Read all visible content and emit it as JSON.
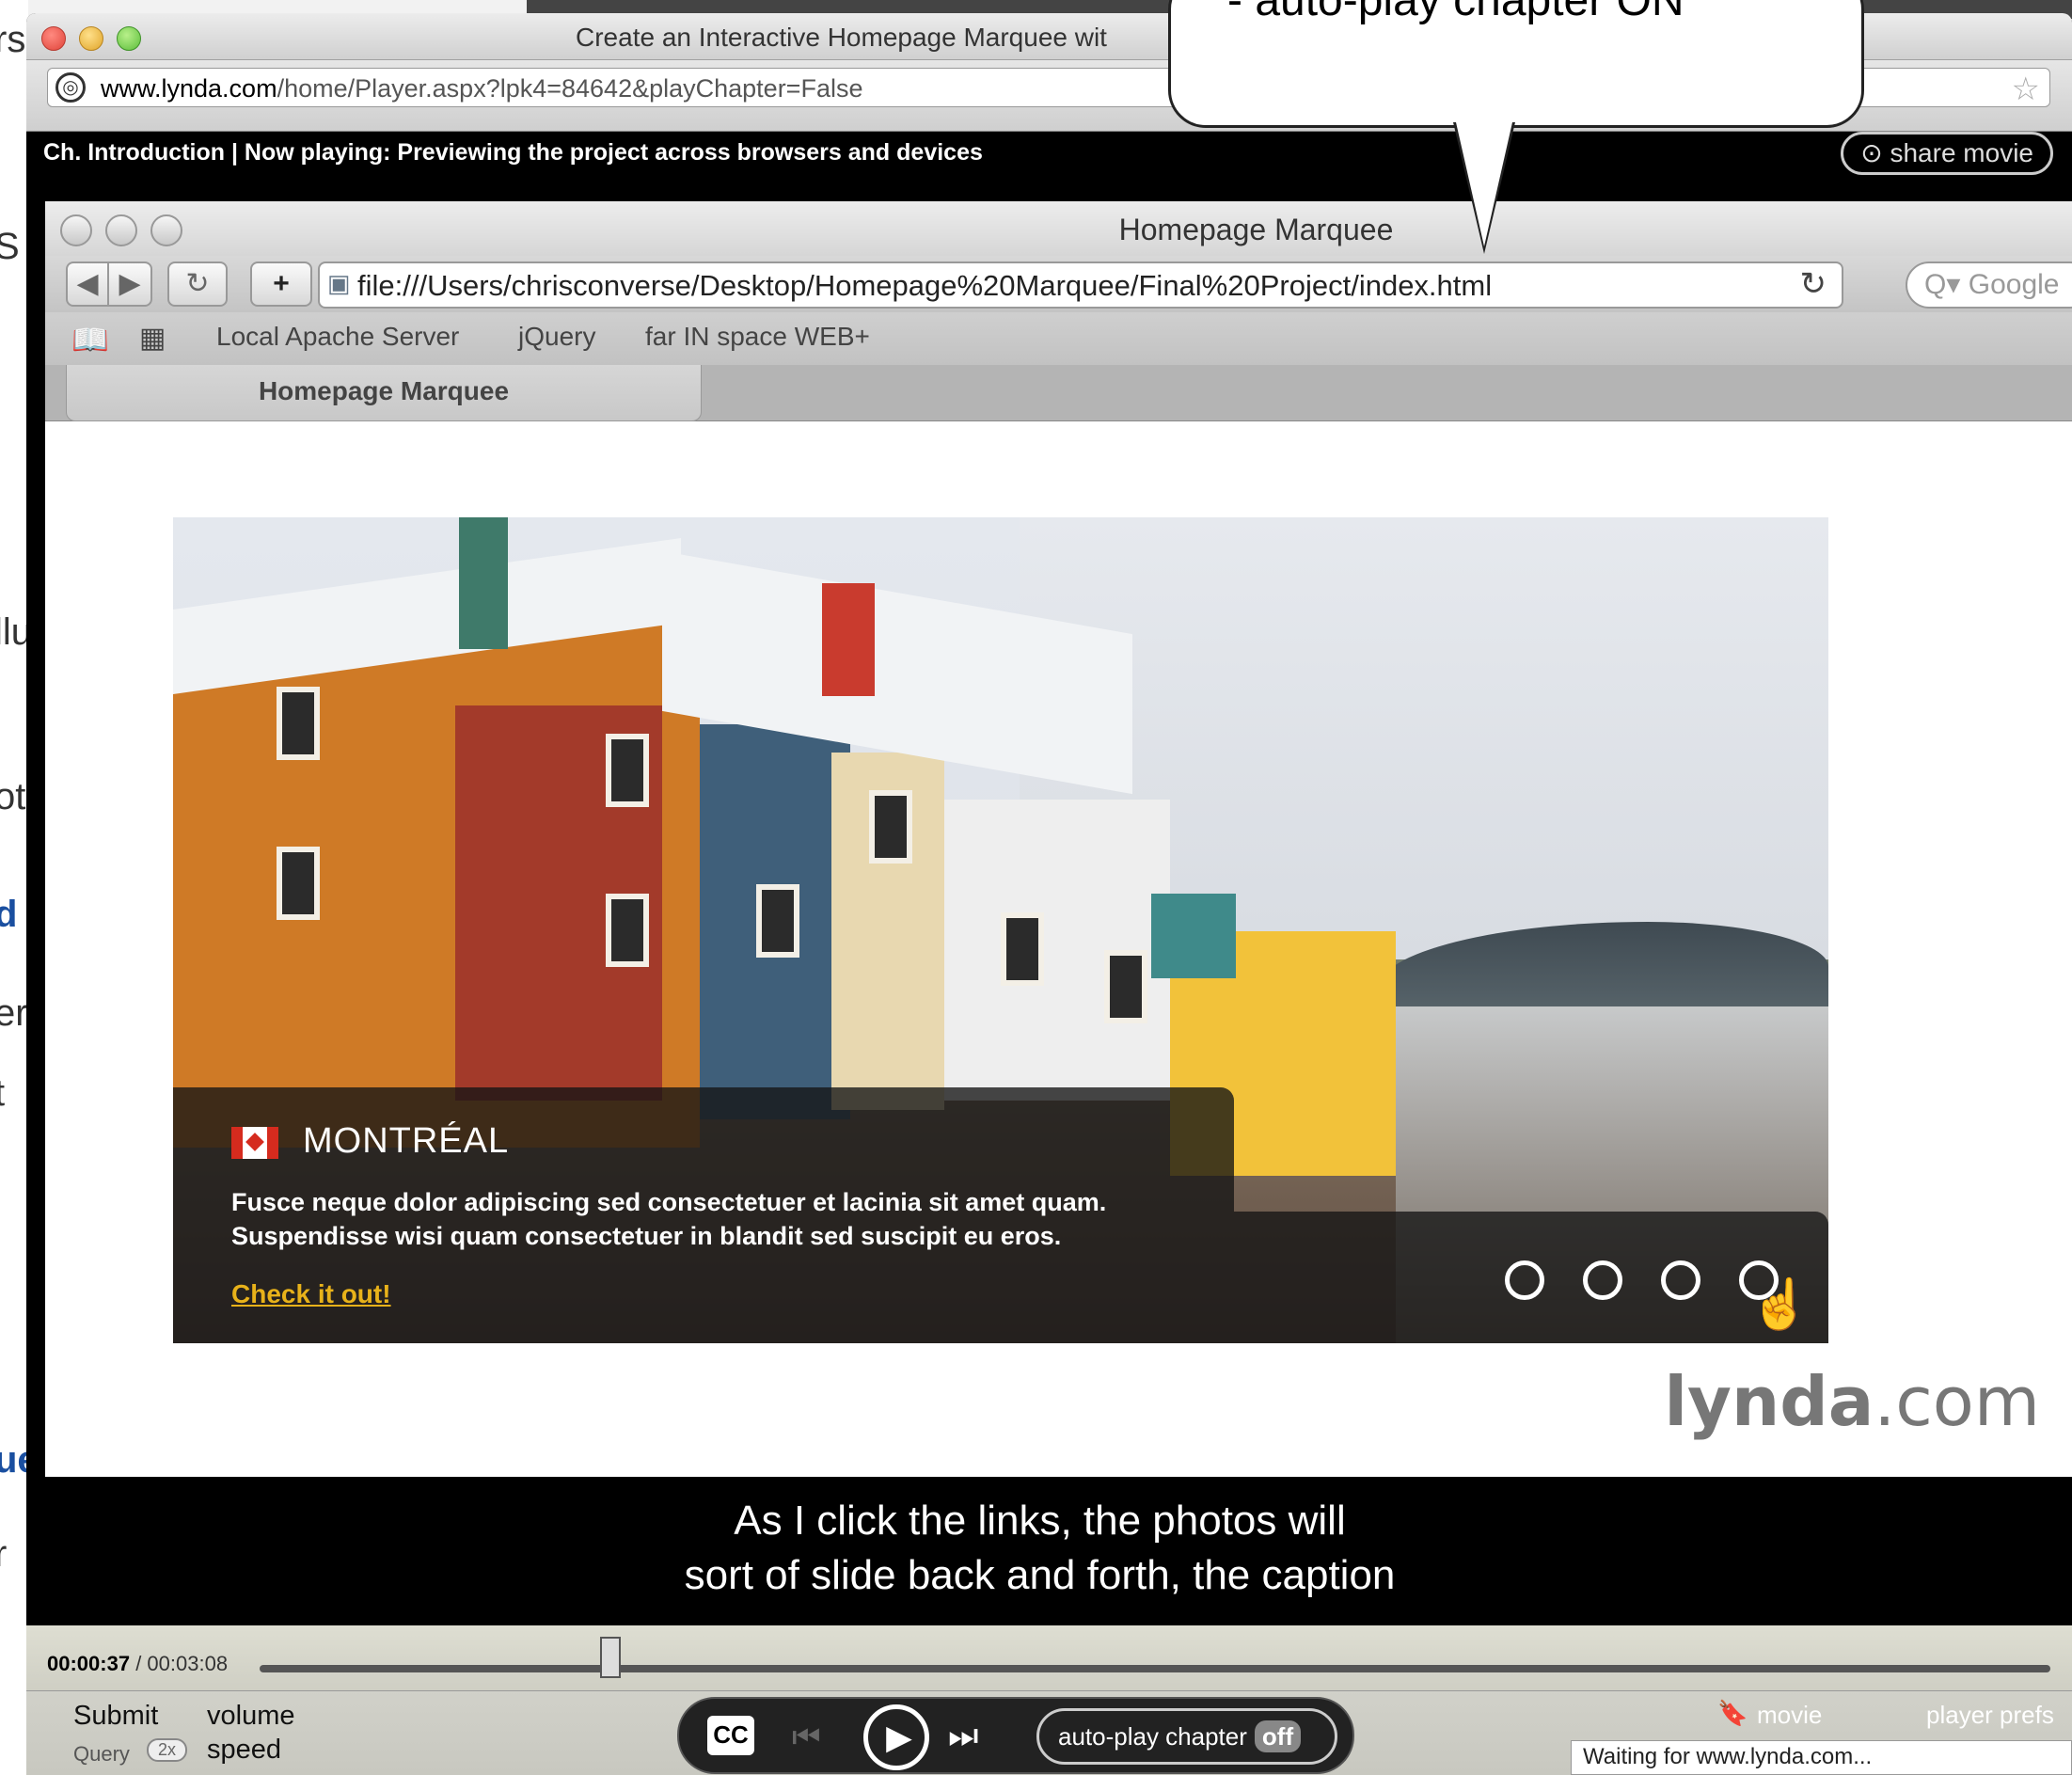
{
  "background": {
    "left_fragments": [
      "rs",
      "S",
      "llu",
      "ot",
      "d",
      "er",
      "t",
      "ue",
      "r"
    ]
  },
  "browser": {
    "window_title": "Create an Interactive Homepage Marquee wit",
    "url_domain": "www.lynda.com",
    "url_path": "/home/Player.aspx?lpk4=84642&playChapter=False"
  },
  "player": {
    "now_playing": "Ch. Introduction | Now playing: Previewing the project across browsers and devices",
    "share_label": "share movie",
    "subtitle_line1": "As I click the links, the photos will",
    "subtitle_line2": "sort of slide back and forth, the caption",
    "time_current": "00:00:37",
    "time_total": "/ 00:03:08",
    "progress_fraction": 0.196,
    "volume_label": "volume",
    "speed_label": "speed",
    "speed_badge": "2x",
    "submit_label": "Submit",
    "query_label": "Query",
    "cc_label": "CC",
    "autoplay_label": "auto-play chapter",
    "autoplay_state": "off",
    "movie_label": "movie",
    "prefs_label": "player prefs",
    "status_text": "Waiting for www.lynda.com..."
  },
  "inner_browser": {
    "title": "Homepage Marquee",
    "url": "file:///Users/chrisconverse/Desktop/Homepage%20Marquee/Final%20Project/index.html",
    "search_placeholder": "Google",
    "bookmarks": [
      "Local Apache Server",
      "jQuery",
      "far IN space WEB+"
    ],
    "tab_label": "Homepage Marquee"
  },
  "marquee": {
    "city": "MONTRÉAL",
    "description_line1": "Fusce neque dolor adipiscing sed consectetuer et lacinia sit amet quam.",
    "description_line2": "Suspendisse wisi quam consectetuer in blandit sed suscipit eu eros.",
    "link_label": "Check it out!",
    "dot_count": 4
  },
  "logo": {
    "brand": "lynda",
    "suffix": ".com"
  },
  "callout": {
    "text": "- auto-play chapter ON"
  }
}
